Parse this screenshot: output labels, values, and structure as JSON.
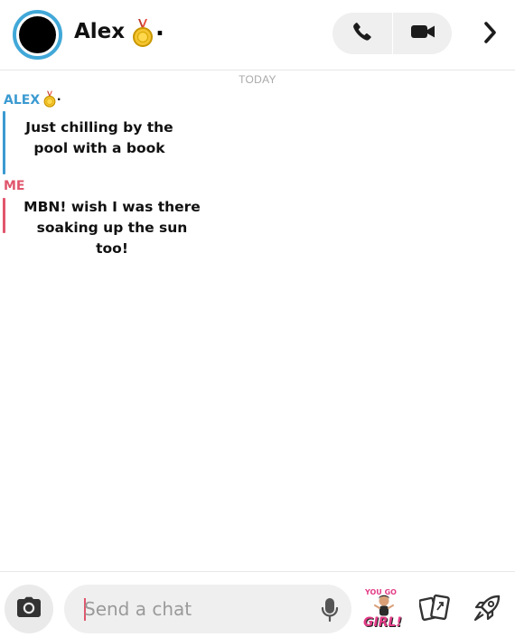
{
  "header": {
    "contact_name": "Alex",
    "name_suffix": ".",
    "medal_icon": "medal-icon",
    "call_icon": "phone-icon",
    "video_icon": "video-camera-icon",
    "more_icon": "chevron-right-icon"
  },
  "conversation": {
    "day_label": "TODAY",
    "messages": [
      {
        "sender": "ALEX",
        "sender_suffix": ".",
        "text": "Just chilling by the pool with a book",
        "color": "#3b9ad1"
      },
      {
        "sender": "ME",
        "text": "MBN!  wish I was there soaking up the sun too!",
        "color": "#e0566c"
      }
    ]
  },
  "composer": {
    "placeholder": "Send a chat",
    "camera_icon": "camera-icon",
    "mic_icon": "microphone-icon",
    "bitmoji": {
      "top_text": "YOU GO",
      "bottom_text": "GIRL!"
    },
    "cards_icon": "cards-icon",
    "rocket_icon": "rocket-icon"
  },
  "colors": {
    "avatar_ring": "#41a8d8",
    "alex": "#3b9ad1",
    "me": "#e0566c",
    "bitmoji_text": "#e23d88"
  }
}
